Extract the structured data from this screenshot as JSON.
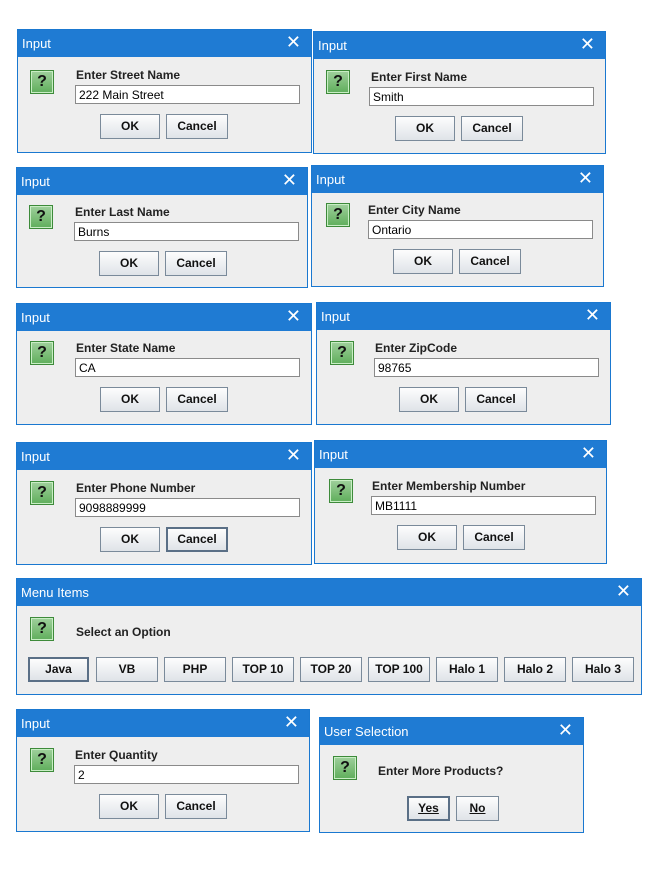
{
  "dialogs": {
    "street": {
      "title": "Input",
      "prompt": "Enter Street Name",
      "value": "222 Main Street",
      "ok": "OK",
      "cancel": "Cancel"
    },
    "first": {
      "title": "Input",
      "prompt": "Enter First Name",
      "value": "Smith",
      "ok": "OK",
      "cancel": "Cancel"
    },
    "last": {
      "title": "Input",
      "prompt": "Enter Last Name",
      "value": "Burns",
      "ok": "OK",
      "cancel": "Cancel"
    },
    "city": {
      "title": "Input",
      "prompt": "Enter City Name",
      "value": "Ontario",
      "ok": "OK",
      "cancel": "Cancel"
    },
    "state": {
      "title": "Input",
      "prompt": "Enter State Name",
      "value": "CA",
      "ok": "OK",
      "cancel": "Cancel"
    },
    "zip": {
      "title": "Input",
      "prompt": "Enter ZipCode",
      "value": "98765",
      "ok": "OK",
      "cancel": "Cancel"
    },
    "phone": {
      "title": "Input",
      "prompt": "Enter Phone Number",
      "value": "9098889999",
      "ok": "OK",
      "cancel": "Cancel"
    },
    "membership": {
      "title": "Input",
      "prompt": "Enter Membership Number",
      "value": "MB1111",
      "ok": "OK",
      "cancel": "Cancel"
    },
    "menu": {
      "title": "Menu Items",
      "prompt": "Select an Option",
      "options": [
        "Java",
        "VB",
        "PHP",
        "TOP 10",
        "TOP 20",
        "TOP 100",
        "Halo 1",
        "Halo 2",
        "Halo 3"
      ]
    },
    "quantity": {
      "title": "Input",
      "prompt": "Enter Quantity",
      "value": "2",
      "ok": "OK",
      "cancel": "Cancel"
    },
    "selection": {
      "title": "User Selection",
      "prompt": "Enter More Products?",
      "yes": "Yes",
      "no": "No"
    }
  },
  "icons": {
    "question": "question-icon",
    "close": "close-icon"
  },
  "close_glyph": "✕",
  "question_glyph": "?"
}
